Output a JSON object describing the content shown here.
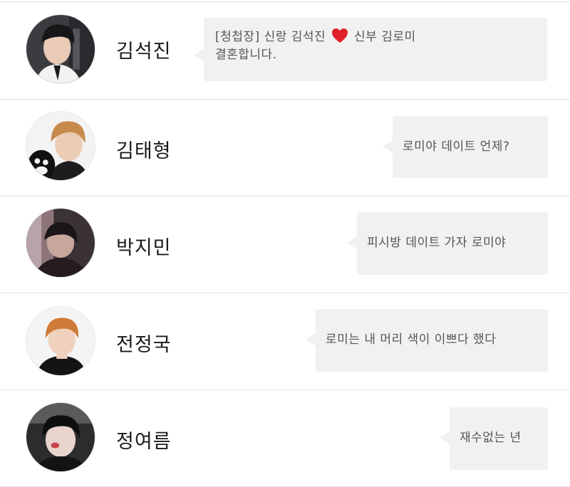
{
  "contacts": [
    {
      "name": "김석진",
      "message_part1": "[청첩장] 신랑 김석진",
      "message_part2": "신부 김로미",
      "message_line2": "결혼합니다.",
      "heart_icon": "red-heart-icon"
    },
    {
      "name": "김태형",
      "message": "로미야 데이트 언제?"
    },
    {
      "name": "박지민",
      "message": "피시방 데이트 가자 로미야"
    },
    {
      "name": "전정국",
      "message": "로미는 내 머리 색이 이쁘다 했다"
    },
    {
      "name": "정여름",
      "message": "재수없는 년"
    }
  ],
  "colors": {
    "bubble": "#f1f1f1",
    "text": "#555555",
    "name": "#1a1a1a",
    "divider": "#e3e3e3",
    "heart": "#e0202a"
  }
}
